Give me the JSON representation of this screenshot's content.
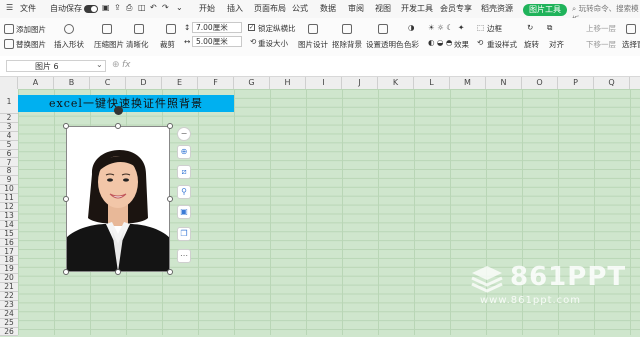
{
  "topbar": {
    "file": "文件",
    "autosave": "自动保存",
    "tabs": [
      "开始",
      "插入",
      "页面布局",
      "公式",
      "数据",
      "审阅",
      "视图",
      "开发工具",
      "会员专享",
      "稻壳资源"
    ],
    "picture_tools": "图片工具",
    "search_placeholder": "玩转命令、搜索模板"
  },
  "ribbon": {
    "add_picture": "添加图片",
    "replace_picture": "替换图片",
    "insert_shape": "插入形状",
    "compress": "压缩图片",
    "clarify": "清晰化",
    "crop": "裁剪",
    "height": "7.00厘米",
    "width": "5.00厘米",
    "lock_ratio": "锁定纵横比",
    "reset_size": "重设大小",
    "picture_design": "图片设计",
    "remove_bg": "抠除背景",
    "set_transparent": "设置透明色",
    "color": "色彩",
    "effects": "效果",
    "border": "边框",
    "reset_style": "重设样式",
    "rotate": "旋转",
    "align": "对齐",
    "bring_forward": "上移一层",
    "send_backward": "下移一层",
    "selection_pane": "选择窗格"
  },
  "formula_bar": {
    "name_box": "图片 6",
    "fx": "fx"
  },
  "columns": [
    "A",
    "B",
    "C",
    "D",
    "E",
    "F",
    "G",
    "H",
    "I",
    "J",
    "K",
    "L",
    "M",
    "N",
    "O",
    "P",
    "Q"
  ],
  "rows": [
    "1",
    "2",
    "3",
    "4",
    "5",
    "6",
    "7",
    "8",
    "9",
    "10",
    "11",
    "12",
    "13",
    "14",
    "15",
    "16",
    "17",
    "18",
    "19",
    "20",
    "21",
    "22",
    "23",
    "24",
    "25",
    "26"
  ],
  "sheet": {
    "title": "excel一键快速换证件照背景"
  },
  "watermark": {
    "brand": "861PPT",
    "url": "www.861ppt.com"
  },
  "colors": {
    "accent_green": "#1fb35a",
    "title_fill": "#00b0f0",
    "sheet_bg": "#cfe6cd"
  }
}
